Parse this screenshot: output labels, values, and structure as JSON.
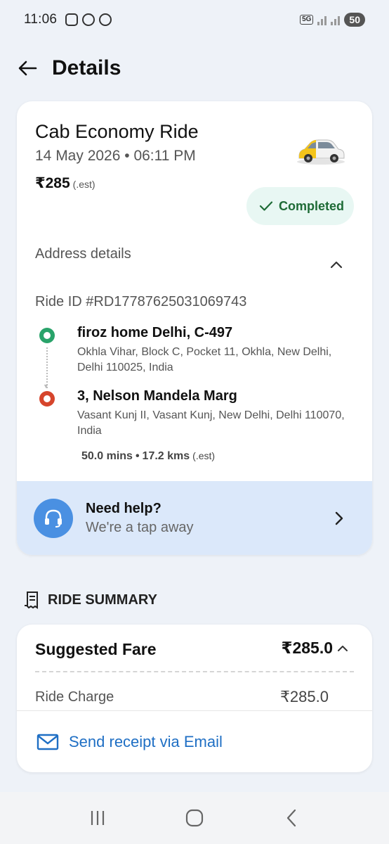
{
  "status_bar": {
    "time": "11:06",
    "network": "5G",
    "battery": "50"
  },
  "header": {
    "title": "Details"
  },
  "ride": {
    "title": "Cab Economy Ride",
    "datetime": "14 May 2026 • 06:11 PM",
    "price": "₹285",
    "price_est": "(.est)",
    "status": "Completed",
    "status_color": "#1e6b36"
  },
  "address": {
    "label": "Address details",
    "ride_id": "Ride ID #RD17787625031069743",
    "pickup": {
      "name": "firoz home Delhi, C-497",
      "address": "Okhla Vihar, Block C, Pocket 11, Okhla, New Delhi, Delhi 110025, India"
    },
    "drop": {
      "name": "3, Nelson Mandela Marg",
      "address": "Vasant Kunj II, Vasant Kunj, New Delhi, Delhi 110070, India"
    },
    "duration": "50.0 mins",
    "distance": "17.2 kms",
    "trip_est": "(.est)"
  },
  "help": {
    "title": "Need help?",
    "subtitle": "We're a tap away"
  },
  "summary": {
    "heading": "RIDE SUMMARY",
    "fare_label": "Suggested Fare",
    "fare_total": "₹285.0",
    "charge_label": "Ride Charge",
    "charge_value": "₹285.0",
    "receipt_label": "Send receipt via Email"
  },
  "colors": {
    "pickup_dot": "#29a36a",
    "drop_dot": "#d6452c",
    "help_bg": "#dbe8fa",
    "link": "#1f6fc4"
  },
  "icons": [
    "back-arrow-icon",
    "car-icon",
    "check-icon",
    "chevron-up-icon",
    "headset-icon",
    "chevron-right-icon",
    "receipt-icon",
    "mail-icon",
    "recents-icon",
    "home-icon",
    "nav-back-icon"
  ]
}
